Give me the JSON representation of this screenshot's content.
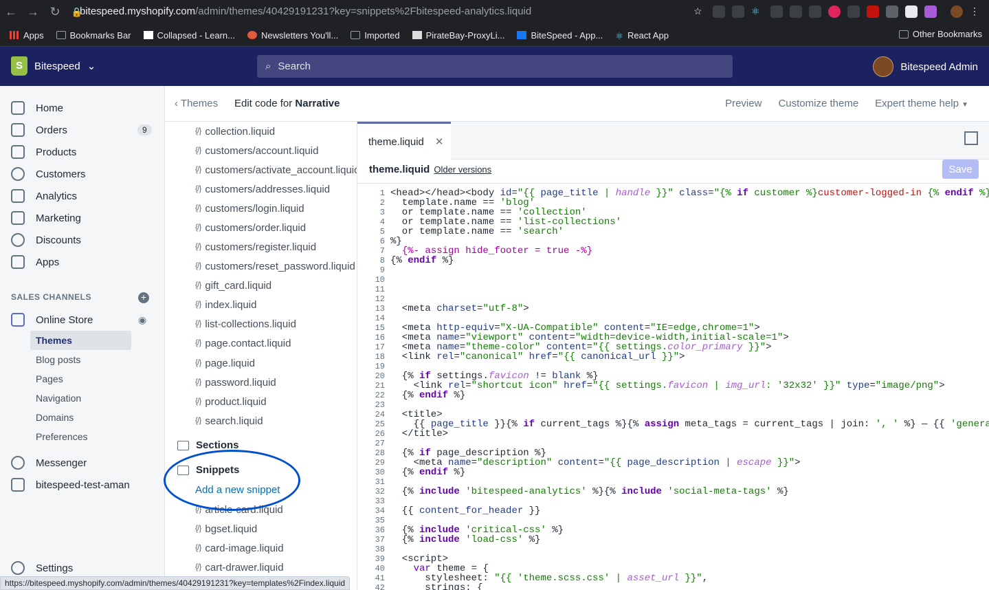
{
  "browser": {
    "url_host": "bitespeed.myshopify.com",
    "url_path": "/admin/themes/40429191231?key=snippets%2Fbitespeed-analytics.liquid",
    "bookmarks": [
      "Apps",
      "Bookmarks Bar",
      "Collapsed - Learn...",
      "Newsletters You'll...",
      "Imported",
      "PirateBay-ProxyLi...",
      "BiteSpeed - App...",
      "React App"
    ],
    "other_bookmarks": "Other Bookmarks"
  },
  "topbar": {
    "store": "Bitespeed",
    "search_placeholder": "Search",
    "admin": "Bitespeed Admin"
  },
  "sidebar": {
    "items": [
      {
        "label": "Home",
        "icon": "home-icon"
      },
      {
        "label": "Orders",
        "icon": "orders-icon",
        "badge": "9"
      },
      {
        "label": "Products",
        "icon": "tag-icon"
      },
      {
        "label": "Customers",
        "icon": "person-icon"
      },
      {
        "label": "Analytics",
        "icon": "chart-icon"
      },
      {
        "label": "Marketing",
        "icon": "megaphone-icon"
      },
      {
        "label": "Discounts",
        "icon": "discount-icon"
      },
      {
        "label": "Apps",
        "icon": "apps-icon"
      }
    ],
    "sales_channels": "SALES CHANNELS",
    "online_store": "Online Store",
    "sub": [
      "Themes",
      "Blog posts",
      "Pages",
      "Navigation",
      "Domains",
      "Preferences"
    ],
    "messenger": "Messenger",
    "test": "bitespeed-test-aman",
    "settings": "Settings"
  },
  "header": {
    "back": "Themes",
    "title_prefix": "Edit code for",
    "theme": "Narrative",
    "actions": [
      "Preview",
      "Customize theme",
      "Expert theme help"
    ]
  },
  "files": {
    "templates": [
      "collection.liquid",
      "customers/account.liquid",
      "customers/activate_account.liquid",
      "customers/addresses.liquid",
      "customers/login.liquid",
      "customers/order.liquid",
      "customers/register.liquid",
      "customers/reset_password.liquid",
      "gift_card.liquid",
      "index.liquid",
      "list-collections.liquid",
      "page.contact.liquid",
      "page.liquid",
      "password.liquid",
      "product.liquid",
      "search.liquid"
    ],
    "sections": "Sections",
    "snippets": "Snippets",
    "add_snippet": "Add a new snippet",
    "snippet_files": [
      "article-card.liquid",
      "bgset.liquid",
      "card-image.liquid",
      "cart-drawer.liquid"
    ]
  },
  "editor": {
    "tab": "theme.liquid",
    "file": "theme.liquid",
    "older": "Older versions",
    "save": "Save"
  },
  "status_url": "https://bitespeed.myshopify.com/admin/themes/40429191231?key=templates%2Findex.liquid"
}
